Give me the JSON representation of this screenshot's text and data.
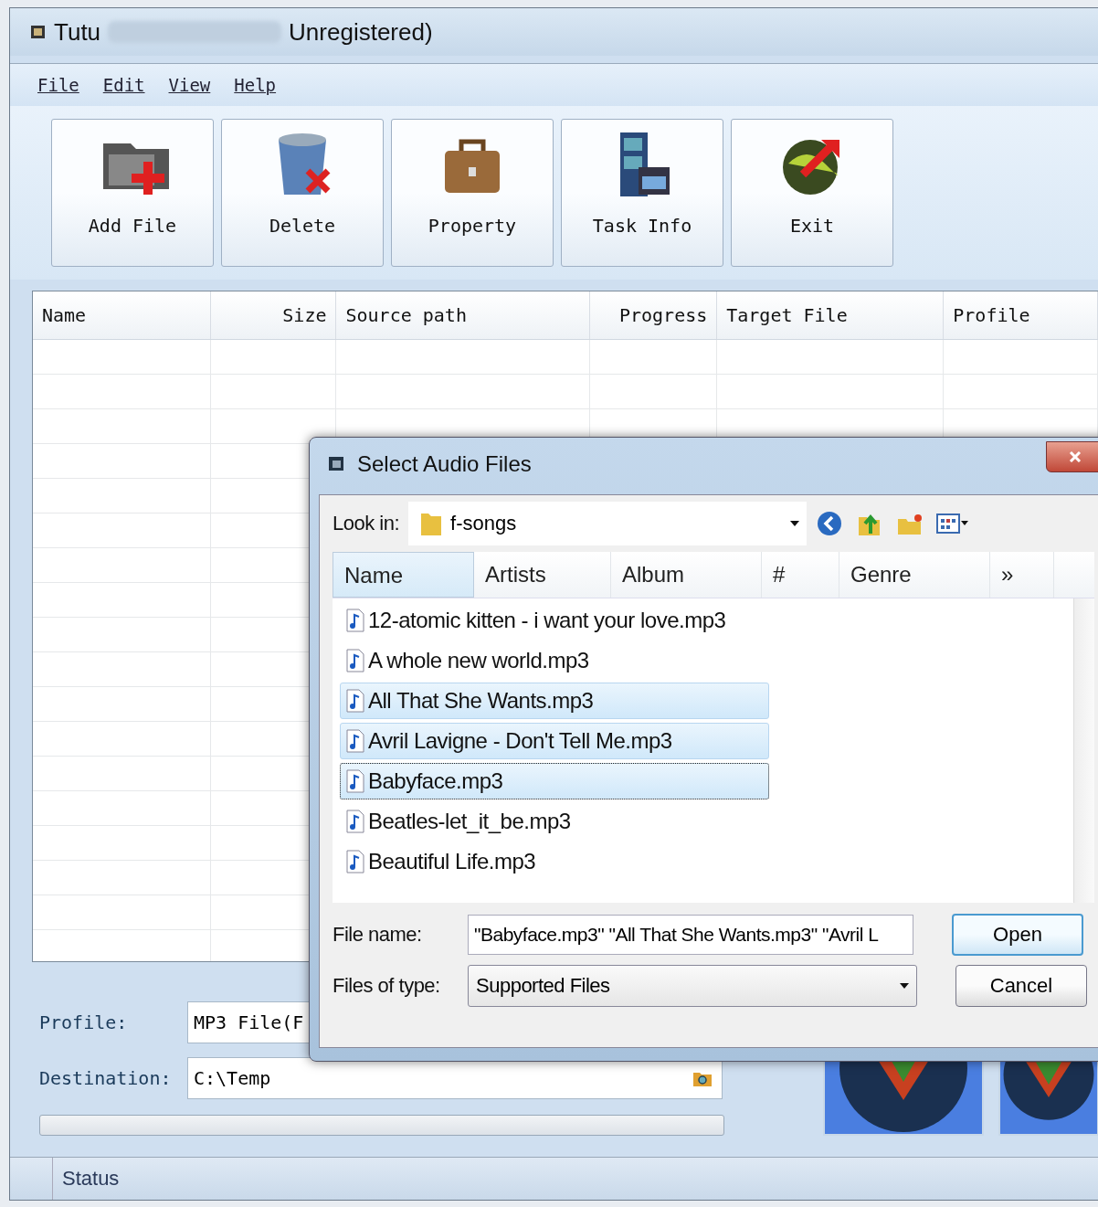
{
  "window": {
    "title_start": "Tutu",
    "title_end": "Unregistered)"
  },
  "menu": [
    {
      "label": "File"
    },
    {
      "label": "Edit"
    },
    {
      "label": "View"
    },
    {
      "label": "Help"
    }
  ],
  "toolbar": [
    {
      "label": "Add File",
      "kind": "add"
    },
    {
      "label": "Delete",
      "kind": "delete"
    },
    {
      "label": "Property",
      "kind": "property"
    },
    {
      "label": "Task Info",
      "kind": "info"
    },
    {
      "label": "Exit",
      "kind": "exit"
    }
  ],
  "table": {
    "columns": [
      {
        "label": "Name"
      },
      {
        "label": "Size"
      },
      {
        "label": "Source path"
      },
      {
        "label": "Progress"
      },
      {
        "label": "Target File"
      },
      {
        "label": "Profile"
      }
    ]
  },
  "settings": {
    "profile_label": "Profile:",
    "profile_value": "MP3 File(F",
    "destination_label": "Destination:",
    "destination_value": "C:\\Temp",
    "progress": {
      "level": 0
    }
  },
  "status_bar": {
    "text": "Status"
  },
  "dialog": {
    "title": "Select Audio Files",
    "look_in_label": "Look in:",
    "look_in_value": "f-songs",
    "columns": [
      {
        "label": "Name",
        "sorted": true
      },
      {
        "label": "Artists",
        "sorted": false
      },
      {
        "label": "Album",
        "sorted": false
      },
      {
        "label": "#",
        "sorted": false
      },
      {
        "label": "Genre",
        "sorted": false
      },
      {
        "label": "»",
        "sorted": false
      }
    ],
    "files": [
      {
        "name": "12-atomic kitten - i want your love.mp3",
        "selected": false,
        "focused": false
      },
      {
        "name": "A whole new world.mp3",
        "selected": false,
        "focused": false
      },
      {
        "name": "All That She Wants.mp3",
        "selected": true,
        "focused": false
      },
      {
        "name": "Avril Lavigne - Don't Tell Me.mp3",
        "selected": true,
        "focused": false
      },
      {
        "name": "Babyface.mp3",
        "selected": true,
        "focused": true
      },
      {
        "name": "Beatles-let_it_be.mp3",
        "selected": false,
        "focused": false
      },
      {
        "name": "Beautiful Life.mp3",
        "selected": false,
        "focused": false
      }
    ],
    "file_name_label": "File name:",
    "file_name_value": "\"Babyface.mp3\" \"All That She Wants.mp3\" \"Avril L",
    "file_type_label": "Files of type:",
    "file_type_value": "Supported Files",
    "buttons": [
      {
        "label": "Open",
        "default": true
      },
      {
        "label": "Cancel",
        "default": false
      }
    ]
  }
}
